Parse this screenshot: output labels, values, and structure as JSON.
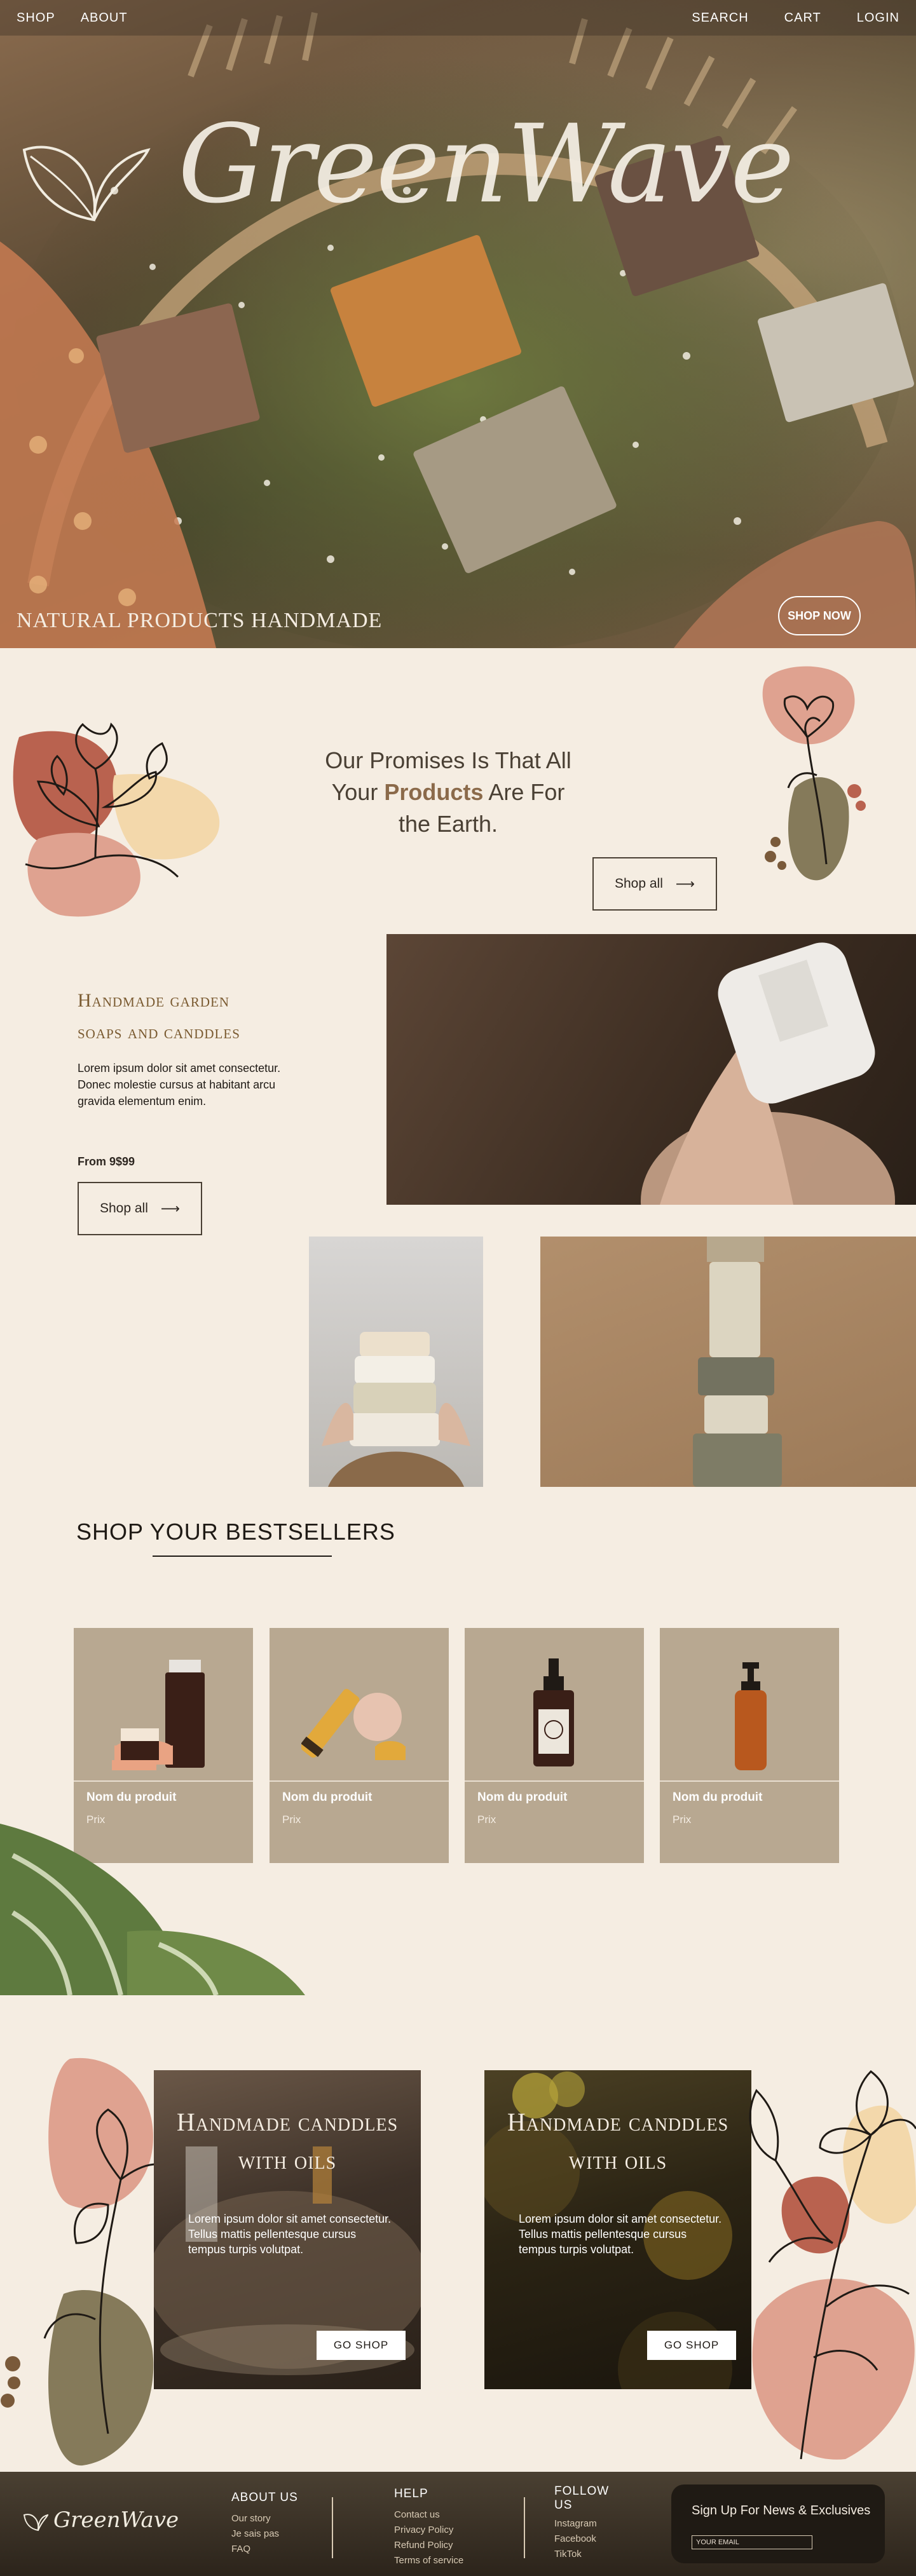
{
  "nav": {
    "left": [
      "SHOP",
      "ABOUT"
    ],
    "right": [
      "SEARCH",
      "CART",
      "LOGIN"
    ]
  },
  "hero": {
    "brand": "GreenWave",
    "tagline": "NATURAL PRODUCTS HANDMADE",
    "button": "SHOP NOW"
  },
  "promise": {
    "line1": "Our Promises Is That All",
    "line2_pre": "Your ",
    "line2_bold": "Products",
    "line2_post": " Are For",
    "line3": "the Earth.",
    "button": "Shop all"
  },
  "intro": {
    "title_line1": "Handmade garden",
    "title_line2": "soaps and canddles",
    "body": "Lorem ipsum dolor sit amet consectetur. Donec molestie cursus at habitant arcu gravida elementum enim.",
    "price": "From 9$99",
    "button": "Shop all"
  },
  "bestsellers": {
    "title": "SHOP YOUR BESTSELLERS",
    "products": [
      {
        "name": "Nom du produit",
        "price": "Prix"
      },
      {
        "name": "Nom du produit",
        "price": "Prix"
      },
      {
        "name": "Nom du produit",
        "price": "Prix"
      },
      {
        "name": "Nom du produit",
        "price": "Prix"
      }
    ]
  },
  "candles": [
    {
      "title_line1": "Handmade canddles",
      "title_line2": "with oils",
      "body": "Lorem ipsum dolor sit amet consectetur. Tellus mattis pellentesque cursus tempus turpis volutpat.",
      "button": "GO SHOP"
    },
    {
      "title_line1": "Handmade canddles",
      "title_line2": "with oils",
      "body": "Lorem ipsum dolor sit amet consectetur. Tellus mattis pellentesque cursus tempus turpis volutpat.",
      "button": "GO SHOP"
    }
  ],
  "footer": {
    "brand": "GreenWave",
    "about": {
      "heading": "ABOUT US",
      "links": [
        "Our story",
        "Je sais pas",
        "FAQ"
      ]
    },
    "help": {
      "heading": "HELP",
      "links": [
        "Contact us",
        "Privacy Policy",
        "Refund Policy",
        "Terms of service"
      ]
    },
    "follow": {
      "heading_line1": "FOLLOW",
      "heading_line2": "US",
      "links": [
        "Instagram",
        "Facebook",
        "TikTok"
      ]
    },
    "signup": {
      "title": "Sign Up For News & Exclusives",
      "placeholder": "YOUR EMAIL"
    }
  },
  "colors": {
    "background": "#f5ede2",
    "terracotta": "#b9624f",
    "blush": "#dfa290",
    "sand": "#f3d8ab",
    "olive": "#857a5a",
    "card": "#b8a891",
    "footer": "#3a3027"
  }
}
